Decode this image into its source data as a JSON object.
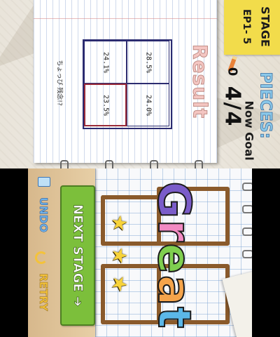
{
  "top_screen": {
    "stage_label": "STAGE",
    "episode_label": "EP1- 5",
    "pieces_label": "PIECES:",
    "now_goal_label": "Now Goal",
    "pieces_count": "4/4",
    "pencil_count": "0",
    "result_title": "Result",
    "result_cells": [
      "28.5%",
      "24.1%",
      "24.0%",
      "23.5%"
    ],
    "hint_text": "ちょっぴ 残念!?",
    "colors": {
      "stage_card": "#f2dc4b",
      "pieces_label": "#8bc9ea",
      "result_title": "#f4c6c2",
      "highlight_cell": "#9a2c3a"
    }
  },
  "bottom_screen": {
    "great_letters": [
      "G",
      "r",
      "e",
      "a",
      "t"
    ],
    "great_colors": [
      "#7a5cc9",
      "#f28ac3",
      "#7fcf4f",
      "#f5a44b",
      "#5bb7e8"
    ],
    "next_stage_label": "NEXT STAGE ➔",
    "undo_label": "UNDO",
    "retry_label": "RETRY",
    "icons": {
      "undo": "eraser-icon",
      "retry": "retry-arrow-icon",
      "star": "star-icon"
    },
    "colors": {
      "next_stage": "#7cbf3b",
      "shape_outline": "#8a5a2b",
      "star": "#f7d33a"
    }
  }
}
